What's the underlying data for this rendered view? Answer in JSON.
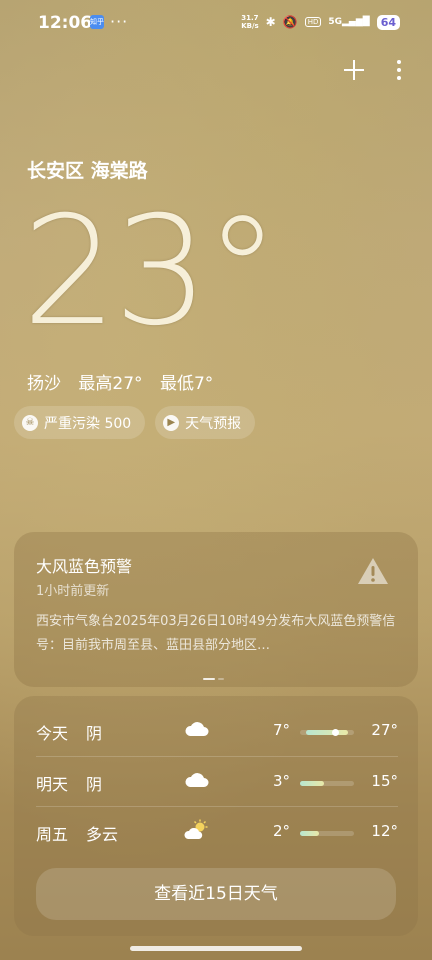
{
  "status_bar": {
    "time": "12:06",
    "app_badge": "知乎",
    "more": "···",
    "net_speed_value": "31.7",
    "net_speed_unit": "KB/s",
    "hd": "HD",
    "signal": "5G",
    "battery": "64"
  },
  "location": "长安区 海棠路",
  "current": {
    "temperature": "23°",
    "condition": "扬沙",
    "high": "最高27°",
    "low": "最低7°"
  },
  "chips": {
    "aqi": "严重污染 500",
    "forecast": "天气预报"
  },
  "alert": {
    "title": "大风蓝色预警",
    "updated": "1小时前更新",
    "body": "西安市气象台2025年03月26日10时49分发布大风蓝色预警信号：目前我市周至县、蓝田县部分地区…"
  },
  "forecast": [
    {
      "day": "今天",
      "condition": "阴",
      "icon": "cloud-icon",
      "low": "7°",
      "high": "27°",
      "range": [
        0.12,
        0.88
      ],
      "current": 0.65
    },
    {
      "day": "明天",
      "condition": "阴",
      "icon": "cloud-icon",
      "low": "3°",
      "high": "15°",
      "range": [
        0.0,
        0.45
      ]
    },
    {
      "day": "周五",
      "condition": "多云",
      "icon": "partly-cloudy-icon",
      "low": "2°",
      "high": "12°",
      "range": [
        0.0,
        0.35
      ]
    }
  ],
  "forecast_button": "查看近15日天气",
  "colors": {
    "background": "#bfa97a",
    "bar_start": "#b8e6d0",
    "bar_end": "#e9e9a8",
    "battery_text": "#6b5fd0"
  }
}
